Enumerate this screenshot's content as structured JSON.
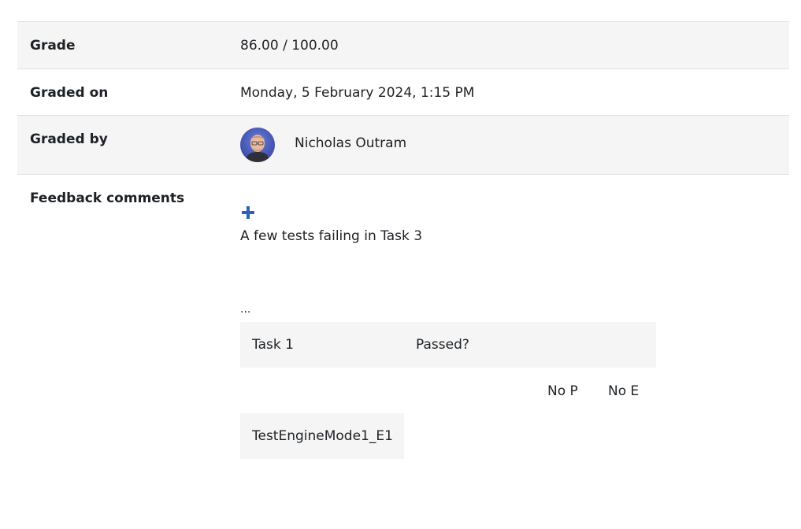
{
  "grade": {
    "label": "Grade",
    "value": "86.00 / 100.00"
  },
  "graded_on": {
    "label": "Graded on",
    "value": "Monday, 5 February 2024, 1:15 PM"
  },
  "graded_by": {
    "label": "Graded by",
    "name": "Nicholas Outram"
  },
  "feedback": {
    "label": "Feedback comments",
    "expand_icon": "plus-icon",
    "text": "A few tests failing in Task 3",
    "ellipsis": "...",
    "table": {
      "task_name": "Task 1",
      "passed_header": "Passed?",
      "sub_headers": [
        "No P",
        "No E"
      ],
      "rows": [
        "TestEngineMode1_E1"
      ]
    }
  },
  "colors": {
    "stripe": "#f5f5f5",
    "border": "#dee2e6",
    "text": "#1d2125",
    "accent": "#0f6cbf"
  }
}
